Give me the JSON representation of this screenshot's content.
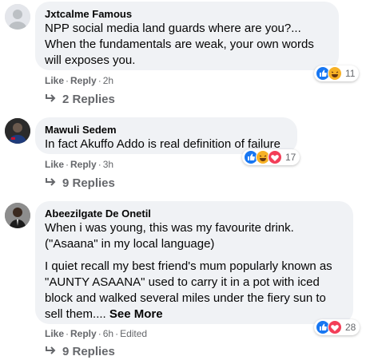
{
  "comments": [
    {
      "author": "Jxtcalme Famous",
      "lines": [
        "NPP social media land guards where are you?...",
        "When the fundamentals are weak, your own words will exposes you."
      ],
      "like": "Like",
      "reply": "Reply",
      "time": "2h",
      "reaction_count": "11",
      "reactions": [
        "like-icon",
        "haha-icon"
      ],
      "replies": "2 Replies"
    },
    {
      "author": "Mawuli Sedem",
      "lines": [
        "In fact Akuffo Addo is real definition of failure"
      ],
      "like": "Like",
      "reply": "Reply",
      "time": "3h",
      "reaction_count": "17",
      "reactions": [
        "like-icon",
        "haha-icon",
        "love-icon"
      ],
      "replies": "9 Replies"
    },
    {
      "author": "Abeezilgate De Onetil",
      "lines": [
        "When i was young, this was my favourite drink.(\"Asaana\" in my local language)",
        "I quiet recall my best friend's mum popularly known as \"AUNTY ASAANA\" used to carry it in a pot with iced block and walked several miles under the fiery sun to sell them...."
      ],
      "see_more": "See More",
      "like": "Like",
      "reply": "Reply",
      "time": "6h",
      "edited": "Edited",
      "reaction_count": "28",
      "reactions": [
        "like-icon",
        "love-icon"
      ],
      "replies": "9 Replies"
    }
  ],
  "colors": {
    "like": "#1877f2",
    "love": "#f33e58",
    "haha": "#f7b125",
    "bubble": "#f0f2f5",
    "meta": "#65676b"
  }
}
